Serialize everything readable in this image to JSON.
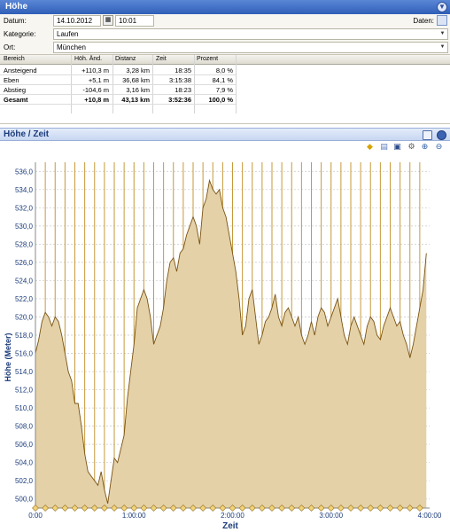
{
  "window": {
    "title": "Höhe",
    "collapse_icon": "chevron-down-icon"
  },
  "form": {
    "datum_label": "Datum:",
    "datum_value": "14.10.2012",
    "time_value": "10:01",
    "daten_label": "Daten:",
    "kategorie_label": "Kategorie:",
    "kategorie_value": "Laufen",
    "ort_label": "Ort:",
    "ort_value": "München"
  },
  "table": {
    "headers": [
      "Bereich",
      "Höh. Änd.",
      "Distanz",
      "Zeit",
      "Prozent"
    ],
    "rows": [
      [
        "Ansteigend",
        "+110,3 m",
        "3,28 km",
        "18:35",
        "8,0 %"
      ],
      [
        "Eben",
        "+5,1 m",
        "36,68 km",
        "3:15:38",
        "84,1 %"
      ],
      [
        "Abstieg",
        "-104,6 m",
        "3,16 km",
        "18:23",
        "7,9 %"
      ],
      [
        "Gesamt",
        "+10,8 m",
        "43,13 km",
        "3:52:36",
        "100,0 %"
      ]
    ]
  },
  "chart_panel": {
    "title": "Höhe / Zeit"
  },
  "chart_data": {
    "type": "area",
    "xlabel": "Zeit",
    "ylabel": "Höhe (Meter)",
    "x_unit": "minutes",
    "xlim": [
      0,
      240
    ],
    "ylim": [
      499,
      537
    ],
    "x_ticks": [
      "0:00",
      "1:00:00",
      "2:00:00",
      "3:00:00",
      "4:00:00"
    ],
    "y_ticks": [
      "500,0",
      "502,0",
      "504,0",
      "506,0",
      "508,0",
      "510,0",
      "512,0",
      "514,0",
      "516,0",
      "518,0",
      "520,0",
      "522,0",
      "524,0",
      "526,0",
      "528,0",
      "530,0",
      "532,0",
      "534,0",
      "536,0"
    ],
    "lap_markers_minutes": [
      0,
      6,
      12,
      18,
      24,
      30,
      36,
      42,
      48,
      54,
      60,
      66,
      72,
      78,
      84,
      90,
      96,
      102,
      108,
      114,
      120,
      126,
      132,
      138,
      144,
      150,
      156,
      162,
      168,
      174,
      180,
      186,
      192,
      198,
      204,
      210,
      216,
      222,
      228,
      234
    ],
    "series": [
      {
        "x": [
          0,
          2,
          4,
          6,
          8,
          10,
          12,
          14,
          16,
          18,
          20,
          22,
          24,
          26,
          28,
          30,
          32,
          34,
          36,
          38,
          40,
          42,
          44,
          46,
          48,
          50,
          52,
          54,
          56,
          58,
          60,
          62,
          64,
          66,
          68,
          70,
          72,
          74,
          76,
          78,
          80,
          82,
          84,
          86,
          88,
          90,
          92,
          94,
          96,
          98,
          100,
          102,
          104,
          106,
          108,
          110,
          112,
          114,
          116,
          118,
          120,
          122,
          124,
          126,
          128,
          130,
          132,
          134,
          136,
          138,
          140,
          142,
          144,
          146,
          148,
          150,
          152,
          154,
          156,
          158,
          160,
          162,
          164,
          166,
          168,
          170,
          172,
          174,
          176,
          178,
          180,
          182,
          184,
          186,
          188,
          190,
          192,
          194,
          196,
          198,
          200,
          202,
          204,
          206,
          208,
          210,
          212,
          214,
          216,
          218,
          220,
          222,
          224,
          226,
          228,
          230,
          232,
          234,
          236,
          238
        ],
        "y": [
          516,
          517.5,
          519.5,
          520.5,
          520,
          519,
          520,
          519.5,
          518,
          516,
          514,
          513,
          510.5,
          510.5,
          508,
          505,
          503,
          502.5,
          502,
          501.5,
          503,
          501,
          499.5,
          502,
          504.5,
          504,
          505.5,
          507,
          511,
          514,
          517,
          521,
          522,
          523,
          522,
          520,
          517,
          518,
          519,
          521,
          524,
          526,
          526.5,
          525,
          527,
          527.5,
          529,
          530,
          531,
          530,
          528,
          532,
          533,
          535,
          534,
          533.5,
          534,
          532,
          531,
          529,
          527,
          525,
          522,
          518,
          519,
          522,
          523,
          520,
          517,
          518,
          519.5,
          520,
          521,
          522.5,
          520,
          519,
          520.5,
          521,
          520,
          519,
          520,
          518,
          517,
          518,
          519.5,
          518,
          520,
          521,
          520.5,
          519,
          520,
          521,
          522,
          520,
          518,
          517,
          519,
          520,
          519,
          518,
          517,
          519,
          520,
          519.5,
          518,
          517.5,
          519,
          520,
          521,
          520,
          519,
          519.5,
          518,
          517,
          515.5,
          517,
          519,
          521,
          523,
          527
        ]
      }
    ],
    "grid": true
  },
  "icons": [
    "calendar-icon",
    "export-icon",
    "collapse-icon",
    "options-icon",
    "marker-icon",
    "chart-type-icon",
    "save-icon",
    "settings-icon",
    "zoom-in-icon",
    "zoom-out-icon"
  ],
  "colors": {
    "title_bar": "#3c6ec5",
    "area_fill": "#e4d1a8",
    "area_line": "#7b5413",
    "lap_line": "#c69a3a",
    "chart_title": "#1b3b7a"
  }
}
